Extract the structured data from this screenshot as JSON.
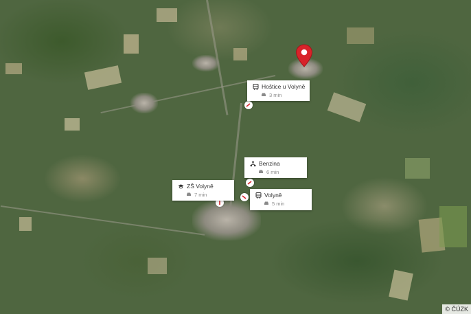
{
  "pois": [
    {
      "name": "Hoštice u Volyně",
      "time": "3 min",
      "icon": "bus-icon"
    },
    {
      "name": "Benzina",
      "time": "6 min",
      "icon": "fuel-network-icon"
    },
    {
      "name": "ZŠ Volyně",
      "time": "7 min",
      "icon": "school-icon"
    },
    {
      "name": "Volyně",
      "time": "5 min",
      "icon": "bus-icon"
    }
  ],
  "travel_mode_icon": "car-icon",
  "pin_icon": "location-pin-icon",
  "pin_color": "#d8232a",
  "copyright": "© ČÚZK"
}
